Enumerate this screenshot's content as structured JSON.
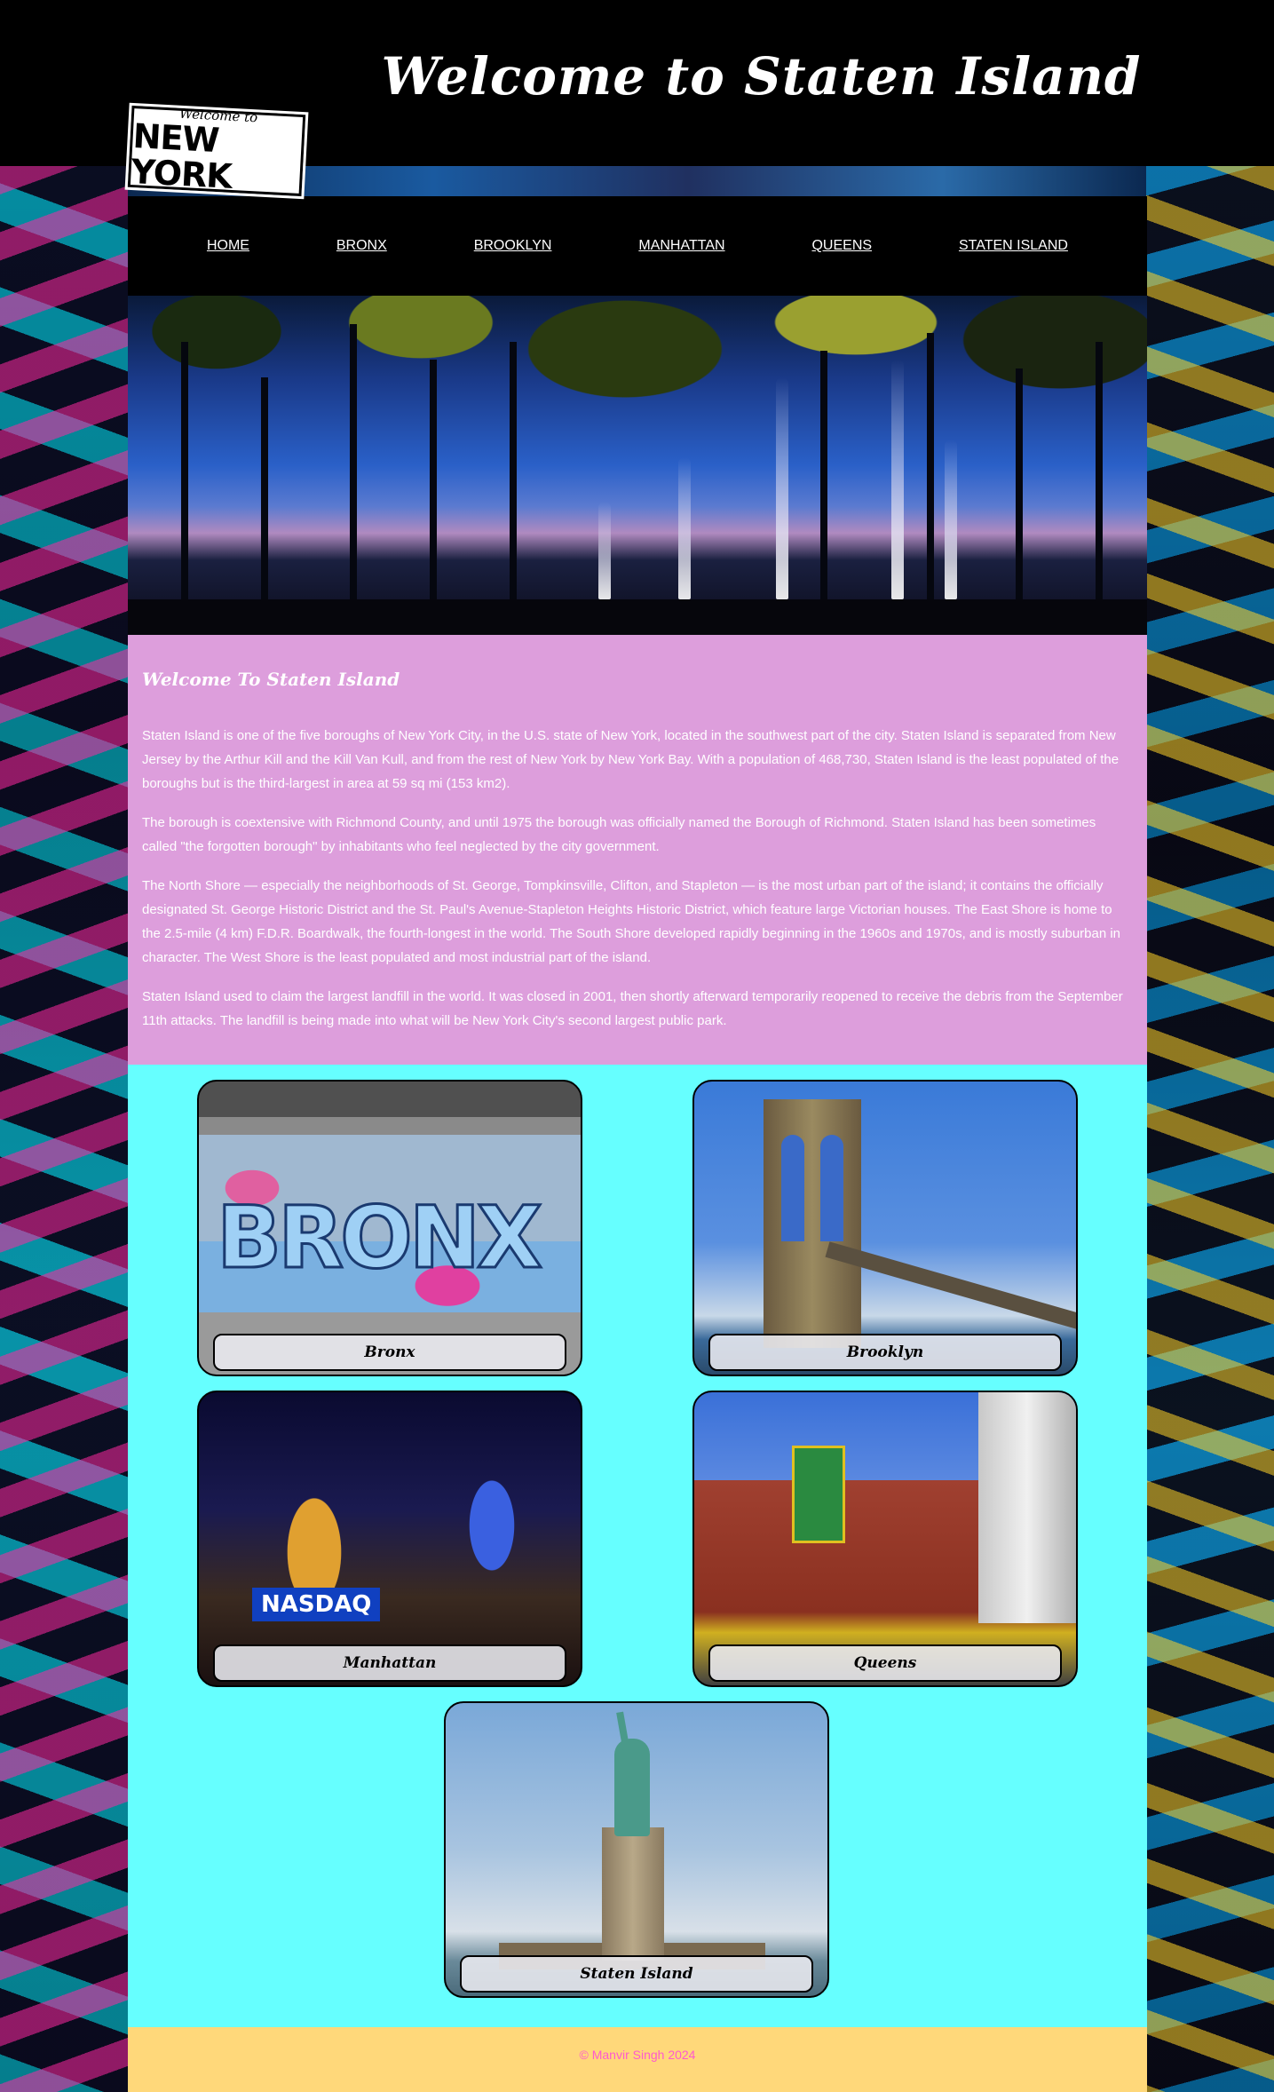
{
  "header": {
    "title": "Welcome to Staten Island",
    "logo": {
      "top_text": "Welcome to",
      "main_text": "NEW YORK"
    }
  },
  "nav": {
    "items": [
      {
        "label": "HOME"
      },
      {
        "label": "BRONX"
      },
      {
        "label": "BROOKLYN"
      },
      {
        "label": "MANHATTAN"
      },
      {
        "label": "QUEENS"
      },
      {
        "label": "STATEN ISLAND"
      }
    ]
  },
  "about": {
    "heading": "Welcome To Staten Island",
    "paragraphs": [
      "Staten Island is one of the five boroughs of New York City, in the U.S. state of New York, located in the southwest part of the city. Staten Island is separated from New Jersey by the Arthur Kill and the Kill Van Kull, and from the rest of New York by New York Bay. With a population of 468,730, Staten Island is the least populated of the boroughs but is the third-largest in area at 59 sq mi (153 km2).",
      "The borough is coextensive with Richmond County, and until 1975 the borough was officially named the Borough of Richmond. Staten Island has been sometimes called \"the forgotten borough\" by inhabitants who feel neglected by the city government.",
      "The North Shore — especially the neighborhoods of St. George, Tompkinsville, Clifton, and Stapleton — is the most urban part of the island; it contains the officially designated St. George Historic District and the St. Paul's Avenue-Stapleton Heights Historic District, which feature large Victorian houses. The East Shore is home to the 2.5-mile (4 km) F.D.R. Boardwalk, the fourth-longest in the world. The South Shore developed rapidly beginning in the 1960s and 1970s, and is mostly suburban in character. The West Shore is the least populated and most industrial part of the island.",
      "Staten Island used to claim the largest landfill in the world. It was closed in 2001, then shortly afterward temporarily reopened to receive the debris from the September 11th attacks. The landfill is being made into what will be New York City's second largest public park."
    ]
  },
  "gallery": {
    "cards": [
      {
        "caption": "Bronx",
        "graffiti": "BRONX"
      },
      {
        "caption": "Brooklyn"
      },
      {
        "caption": "Manhattan",
        "sign": "NASDAQ"
      },
      {
        "caption": "Queens"
      },
      {
        "caption": "Staten Island"
      }
    ]
  },
  "footer": {
    "text": "© Manvir Singh 2024"
  },
  "colors": {
    "about_bg": "#dd9edc",
    "gallery_bg": "#66ffff",
    "footer_bg": "#ffd87a",
    "footer_text": "#ff5acd"
  }
}
